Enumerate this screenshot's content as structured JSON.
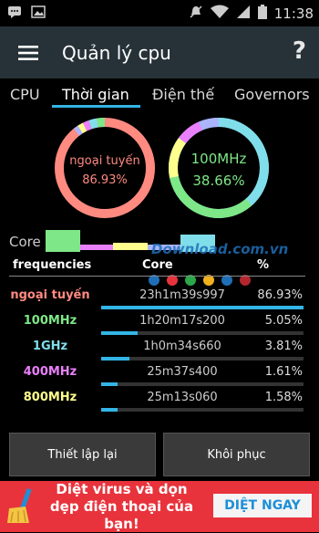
{
  "statusbar": {
    "time": "11:38"
  },
  "appbar": {
    "title": "Quản lý cpu",
    "help": "?"
  },
  "tabs": [
    {
      "label": "CPU",
      "active": false
    },
    {
      "label": "Thời gian",
      "active": true
    },
    {
      "label": "Điện thế",
      "active": false
    },
    {
      "label": "Governors",
      "active": false
    }
  ],
  "rings": {
    "left": {
      "name": "ngoại tuyến",
      "percent": "86.93%",
      "color": "#ff8a80"
    },
    "right": {
      "name": "100MHz",
      "percent": "38.66%",
      "color": "#7ee787"
    }
  },
  "core_label": "Core",
  "table": {
    "headers": {
      "freq": "frequencies",
      "core": "Core",
      "pct": "%"
    },
    "rows": [
      {
        "freq": "ngoại tuyến",
        "time": "23h1m39s997",
        "pct": "86.93%",
        "color": "#ff8a80",
        "fraction": 1.0
      },
      {
        "freq": "100MHz",
        "time": "1h20m17s200",
        "pct": "5.05%",
        "color": "#7ee787",
        "fraction": 0.18
      },
      {
        "freq": "1GHz",
        "time": "1h0m34s660",
        "pct": "3.81%",
        "color": "#80deea",
        "fraction": 0.14
      },
      {
        "freq": "400MHz",
        "time": "25m37s400",
        "pct": "1.61%",
        "color": "#ea80fc",
        "fraction": 0.08
      },
      {
        "freq": "800MHz",
        "time": "25m13s060",
        "pct": "1.58%",
        "color": "#ffff8d",
        "fraction": 0.08
      }
    ]
  },
  "buttons": {
    "reset": "Thiết lập lại",
    "restore": "Khôi phục"
  },
  "ad": {
    "text": "Diệt virus và dọn dẹp điện thoại của bạn!",
    "cta": "DIỆT NGAY"
  },
  "watermark": "Download.com.vn",
  "colors": {
    "accent": "#33b5e5",
    "appbar": "#263238",
    "ad": "#e8333c"
  }
}
